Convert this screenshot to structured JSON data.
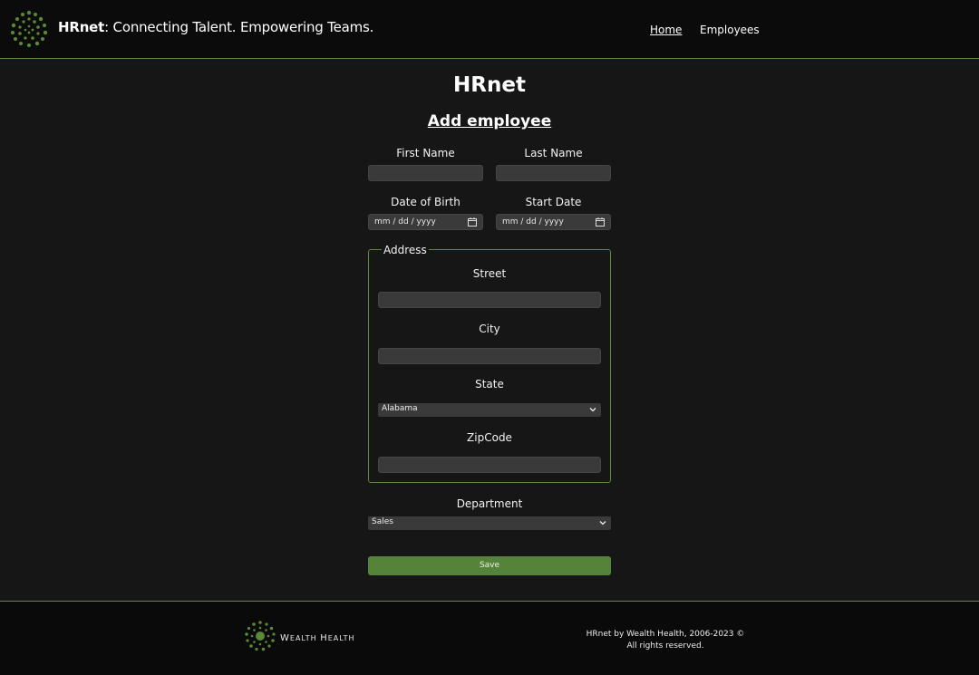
{
  "header": {
    "brand_bold": "HRnet",
    "brand_rest": ": Connecting Talent. Empowering Teams.",
    "nav_home": "Home",
    "nav_employees": "Employees",
    "accent_color": "#5f8a3e"
  },
  "main": {
    "page_title": "HRnet",
    "form_title": "Add employee",
    "first_name_label": "First Name",
    "last_name_label": "Last Name",
    "dob_label": "Date of Birth",
    "dob_placeholder": "mm / dd / yyyy",
    "start_date_label": "Start Date",
    "start_date_placeholder": "mm / dd / yyyy",
    "address": {
      "legend": "Address",
      "street_label": "Street",
      "city_label": "City",
      "state_label": "State",
      "state_value": "Alabama",
      "zip_label": "ZipCode"
    },
    "department_label": "Department",
    "department_value": "Sales",
    "save_label": "Save",
    "save_color": "#56833a"
  },
  "footer": {
    "logo_text_w": "W",
    "logo_text_rest": "EALTH ",
    "logo_text_h": "H",
    "logo_text_rest2": "EALTH",
    "copyright_line1": "HRnet by Wealth Health, 2006-2023 ©",
    "copyright_line2": "All rights reserved."
  },
  "icons": [
    "hrnet-logo-icon",
    "calendar-icon",
    "chevron-down-icon",
    "wealth-health-logo-icon"
  ]
}
